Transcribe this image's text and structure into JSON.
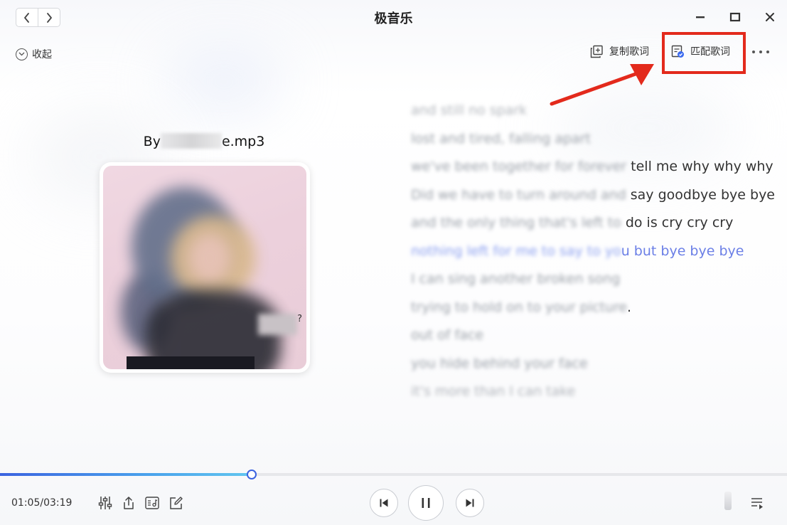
{
  "window": {
    "title": "极音乐"
  },
  "header": {
    "collapse_label": "收起",
    "copy_lyrics_label": "复制歌词",
    "match_lyrics_label": "匹配歌词"
  },
  "song": {
    "file_prefix": "By",
    "file_suffix": "e.mp3"
  },
  "lyrics": [
    {
      "blurred": "and still no spark",
      "visible": "",
      "state": "dim"
    },
    {
      "blurred": "lost and tired, falling apart",
      "visible": "",
      "state": "normal"
    },
    {
      "blurred": "we've been together for forever",
      "visible": " tell me why why why",
      "state": "normal"
    },
    {
      "blurred": "Did we have to turn around and",
      "visible": " say goodbye bye bye",
      "state": "normal"
    },
    {
      "blurred": "and the only thing that's left to",
      "visible": " do is cry cry cry",
      "state": "normal"
    },
    {
      "blurred": "nothing left for me to say to yo",
      "visible": "u but bye bye bye",
      "state": "current"
    },
    {
      "blurred": "I can sing another broken song",
      "visible": "",
      "state": "normal"
    },
    {
      "blurred": "trying to hold on to your picture",
      "visible": ".",
      "state": "normal"
    },
    {
      "blurred": "out of face",
      "visible": "",
      "state": "normal"
    },
    {
      "blurred": "you hide behind your face",
      "visible": "",
      "state": "normal"
    },
    {
      "blurred": "it's more than I can take",
      "visible": "",
      "state": "dim"
    }
  ],
  "player": {
    "time_display": "01:05/03:19",
    "progress_fraction": 0.32
  },
  "icons": {
    "nav_back": "chevron-left-icon",
    "nav_forward": "chevron-right-icon",
    "minimize": "minimize-icon",
    "maximize": "maximize-icon",
    "close": "close-icon",
    "copy": "copy-icon",
    "match": "match-lyrics-icon",
    "more": "more-icon",
    "equalizer": "equalizer-icon",
    "share": "share-icon",
    "lyrics_panel": "lyrics-icon",
    "edit": "edit-icon",
    "prev": "previous-icon",
    "pause": "pause-icon",
    "next": "next-icon",
    "volume": "volume-icon",
    "playlist": "playlist-icon"
  },
  "colors": {
    "accent": "#3b63e0",
    "current_lyric": "#6b7fe6",
    "annotation_red": "#e32a1c"
  }
}
